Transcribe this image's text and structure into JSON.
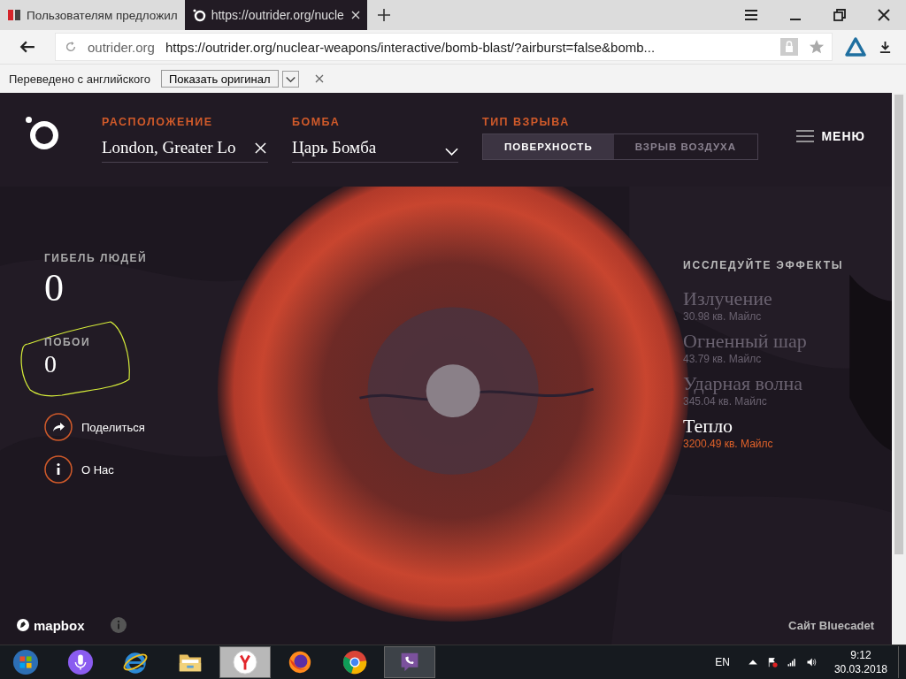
{
  "browser": {
    "tabs": [
      {
        "title": "Пользователям предложил",
        "selected": false,
        "kind": "news"
      },
      {
        "title": "https://outrider.org/nucle",
        "selected": true,
        "kind": "site"
      }
    ],
    "address": {
      "domain": "outrider.org",
      "url": "https://outrider.org/nuclear-weapons/interactive/bomb-blast/?airburst=false&bomb..."
    },
    "translate_bar": {
      "text": "Переведено с английского",
      "button": "Показать оригинал"
    }
  },
  "header": {
    "location": {
      "label": "РАСПОЛОЖЕНИЕ",
      "value": "London, Greater Lo"
    },
    "bomb": {
      "label": "БОМБА",
      "value": "Царь Бомба"
    },
    "blast_type": {
      "label": "ТИП ВЗРЫВА",
      "options": [
        {
          "label": "ПОВЕРХНОСТЬ",
          "selected": true
        },
        {
          "label": "ВЗРЫВ ВОЗДУХА",
          "selected": false
        }
      ]
    },
    "menu": "МЕНЮ"
  },
  "stats": [
    {
      "label": "ГИБЕЛЬ ЛЮДЕЙ",
      "value": "0"
    },
    {
      "label": "ПОБОИ",
      "value": "0"
    }
  ],
  "actions": [
    {
      "label": "Поделиться",
      "kind": "share"
    },
    {
      "label": "О Нас",
      "kind": "info"
    }
  ],
  "effects": {
    "title": "ИССЛЕДУЙТЕ ЭФФЕКТЫ",
    "items": [
      {
        "name": "Излучение",
        "value": "30.98 кв. Майлс",
        "selected": false
      },
      {
        "name": "Огненный шар",
        "value": "43.79 кв. Майлс",
        "selected": false
      },
      {
        "name": "Ударная волна",
        "value": "345.04 кв. Майлс",
        "selected": false
      },
      {
        "name": "Тепло",
        "value": "3200.49 кв. Майлс",
        "selected": true
      }
    ]
  },
  "map_footer": {
    "attribution": "mapbox",
    "credit": "Сайт Bluecadet"
  },
  "taskbar": {
    "apps": [
      {
        "kind": "start",
        "selected": false
      },
      {
        "kind": "mic",
        "selected": false
      },
      {
        "kind": "ie",
        "selected": false
      },
      {
        "kind": "folder",
        "selected": false
      },
      {
        "kind": "yandex",
        "selected": true
      },
      {
        "kind": "firefox",
        "selected": false
      },
      {
        "kind": "chrome",
        "selected": false
      },
      {
        "kind": "viber",
        "selected": true
      }
    ],
    "language": "EN",
    "time": "9:12",
    "date": "30.03.2018"
  }
}
